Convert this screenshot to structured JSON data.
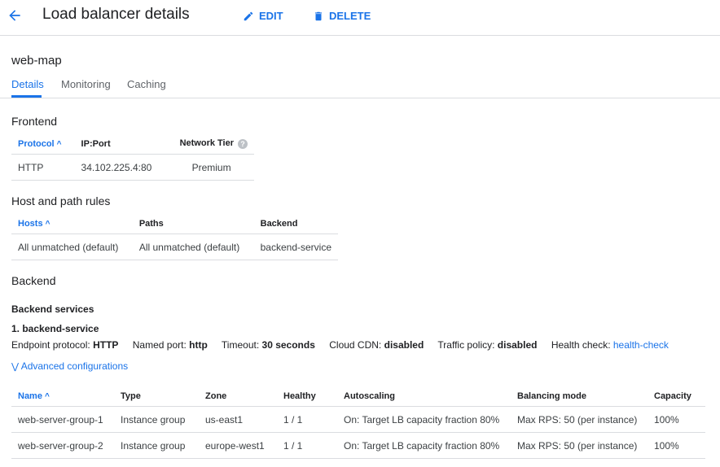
{
  "header": {
    "title": "Load balancer details",
    "edit_label": "EDIT",
    "delete_label": "DELETE"
  },
  "lb_name": "web-map",
  "tabs": [
    {
      "label": "Details",
      "active": true
    },
    {
      "label": "Monitoring",
      "active": false
    },
    {
      "label": "Caching",
      "active": false
    }
  ],
  "frontend": {
    "heading": "Frontend",
    "columns": [
      "Protocol",
      "IP:Port",
      "Network Tier"
    ],
    "rows": [
      [
        "HTTP",
        "34.102.225.4:80",
        "Premium"
      ]
    ]
  },
  "host_path": {
    "heading": "Host and path rules",
    "columns": [
      "Hosts",
      "Paths",
      "Backend"
    ],
    "rows": [
      [
        "All unmatched (default)",
        "All unmatched (default)",
        "backend-service"
      ]
    ]
  },
  "backend": {
    "heading": "Backend",
    "services_heading": "Backend services",
    "service_name": "1. backend-service",
    "props": {
      "endpoint_label": "Endpoint protocol:",
      "endpoint_value": "HTTP",
      "port_label": "Named port:",
      "port_value": "http",
      "timeout_label": "Timeout:",
      "timeout_value": "30 seconds",
      "cdn_label": "Cloud CDN:",
      "cdn_value": "disabled",
      "traffic_label": "Traffic policy:",
      "traffic_value": "disabled",
      "health_label": "Health check:",
      "health_value": "health-check"
    },
    "advanced_label": "Advanced configurations",
    "columns": [
      "Name",
      "Type",
      "Zone",
      "Healthy",
      "Autoscaling",
      "Balancing mode",
      "Capacity"
    ],
    "rows": [
      [
        "web-server-group-1",
        "Instance group",
        "us-east1",
        "1 / 1",
        "On: Target LB capacity fraction 80%",
        "Max RPS: 50 (per instance)",
        "100%"
      ],
      [
        "web-server-group-2",
        "Instance group",
        "europe-west1",
        "1 / 1",
        "On: Target LB capacity fraction 80%",
        "Max RPS: 50 (per instance)",
        "100%"
      ]
    ]
  },
  "colors": {
    "accent": "#1a73e8",
    "divider": "#dadce0",
    "text": "#202124"
  },
  "icons": {
    "back": "arrow-back-icon",
    "edit": "pencil-icon",
    "delete": "trash-icon",
    "sort": "arrow-up-icon",
    "help": "help-icon",
    "expand": "chevron-double-down-icon"
  }
}
